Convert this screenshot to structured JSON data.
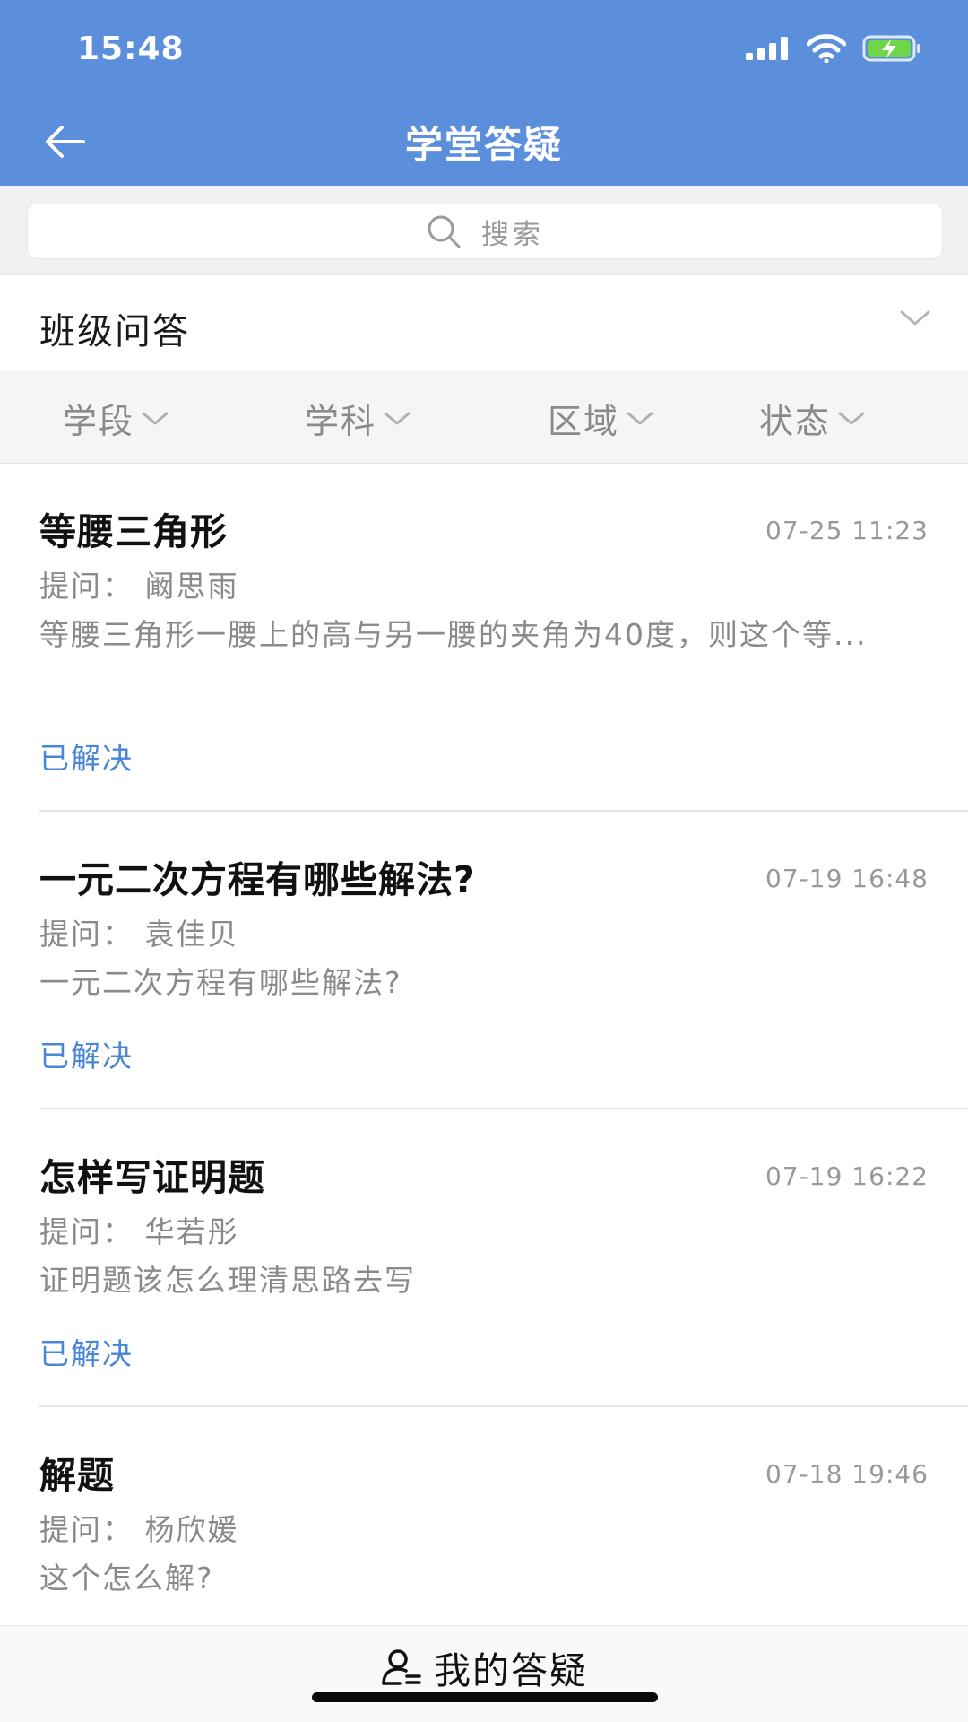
{
  "status_bar": {
    "time": "15:48"
  },
  "header": {
    "title": "学堂答疑",
    "back_icon": "arrow-left-icon"
  },
  "search": {
    "placeholder": "搜索"
  },
  "category": {
    "label": "班级问答"
  },
  "filters": [
    "学段",
    "学科",
    "区域",
    "状态"
  ],
  "questions": [
    {
      "title": "等腰三角形",
      "time": "07-25 11:23",
      "asker": "提问：  阚思雨",
      "desc": "等腰三角形一腰上的高与另一腰的夹角为40度，则这个等...",
      "status": "已解决"
    },
    {
      "title": "一元二次方程有哪些解法?",
      "time": "07-19 16:48",
      "asker": "提问：  袁佳贝",
      "desc": "一元二次方程有哪些解法?",
      "status": "已解决"
    },
    {
      "title": "怎样写证明题",
      "time": "07-19 16:22",
      "asker": "提问：  华若彤",
      "desc": "证明题该怎么理清思路去写",
      "status": "已解决"
    },
    {
      "title": "解题",
      "time": "07-18 19:46",
      "asker": "提问：  杨欣媛",
      "desc": "这个怎么解?",
      "status": ""
    }
  ],
  "bottom_bar": {
    "label": "我的答疑",
    "icon": "user-icon"
  },
  "colors": {
    "header_bg": "#5b8fdc",
    "status_blue": "#4a86d6"
  }
}
